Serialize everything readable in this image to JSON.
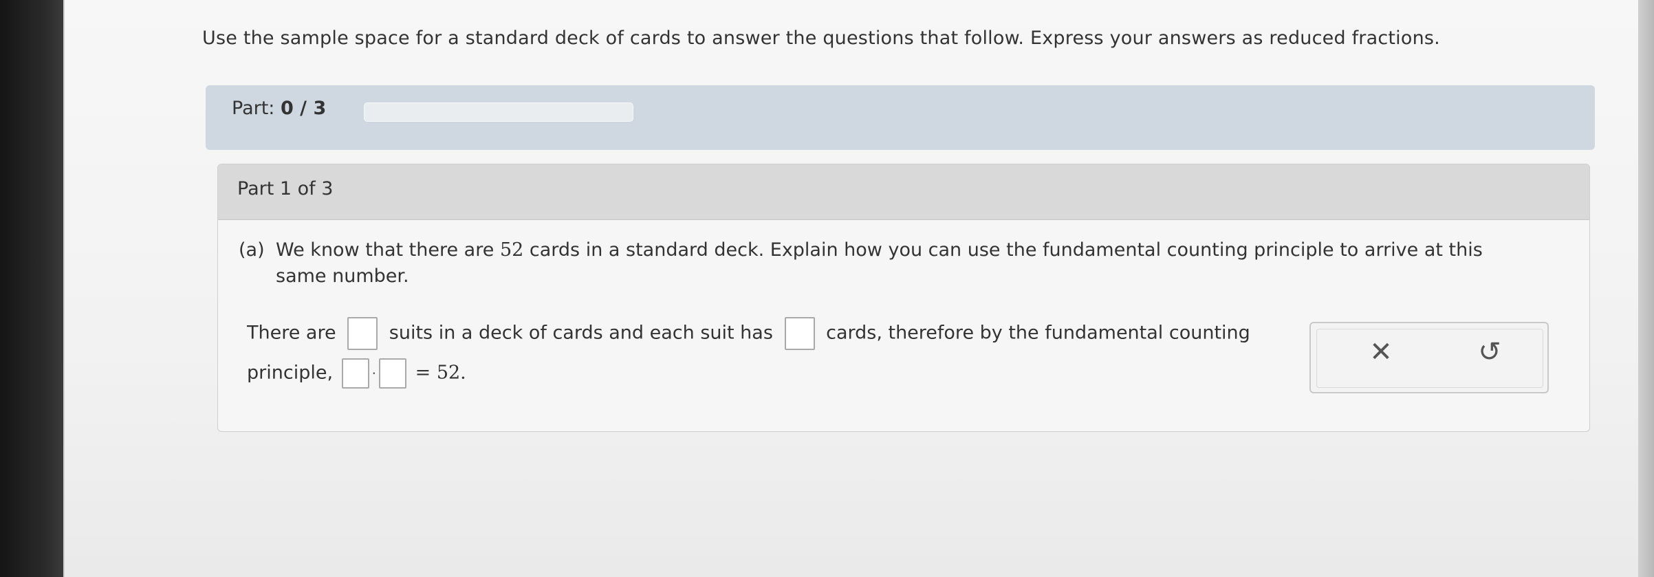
{
  "instruction": "Use the sample space for a standard deck of cards to answer the questions that follow. Express your answers as reduced fractions.",
  "progress": {
    "label": "Part:",
    "value": "0 / 3",
    "fraction": 0
  },
  "part": {
    "header": "Part 1 of 3",
    "question_label": "(a)",
    "question_text_1": "We know that there are",
    "question_number": "52",
    "question_text_2": "cards in a standard deck. Explain how you can use the fundamental counting principle to arrive at this same number.",
    "answer_1a": "There are",
    "answer_1b": "suits in a deck of cards and each suit has",
    "answer_1c": "cards, therefore by the fundamental counting",
    "answer_2a": "principle,",
    "answer_2b": "=",
    "answer_2c": "52."
  },
  "tools": {
    "clear_glyph": "✕",
    "undo_glyph": "↺"
  },
  "sidebar": {
    "icons": [
      "glasses-icon",
      "pencil-icon",
      "notes-icon",
      "calculator-icon",
      "mail-icon"
    ]
  }
}
